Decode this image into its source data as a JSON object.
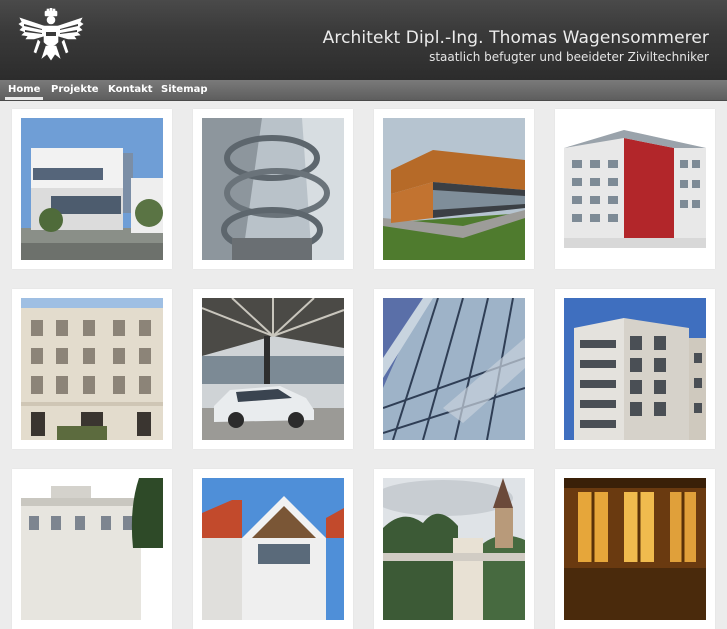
{
  "header": {
    "title": "Architekt Dipl.-Ing. Thomas Wagensommerer",
    "subtitle": "staatlich befugter und beeideter Ziviltechniker",
    "logo_icon": "austrian-eagle-emblem-icon"
  },
  "nav": {
    "items": [
      {
        "label": "Home",
        "active": true
      },
      {
        "label": "Projekte",
        "active": false
      },
      {
        "label": "Kontakt",
        "active": false
      },
      {
        "label": "Sitemap",
        "active": false
      }
    ]
  },
  "colors": {
    "header_bg": "#3a3a3a",
    "nav_bg": "#6b6b6b",
    "page_bg": "#ececec",
    "tile_bg": "#ffffff"
  },
  "gallery": {
    "rows": 3,
    "columns": 4
  }
}
